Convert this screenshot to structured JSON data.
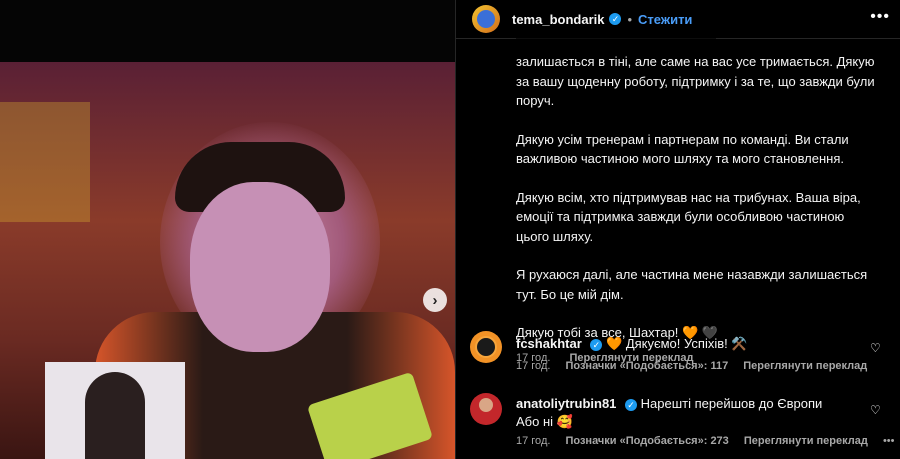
{
  "post": {
    "username": "tema_bondarik",
    "follow_label": "Стежити",
    "more_icon": "•••",
    "caption_paragraphs": [
      "залишається в тіні, але саме на вас усе тримається. Дякую за вашу щоденну роботу, підтримку і за те, що завжди були поруч.",
      "Дякую усім тренерам і партнерам по команді. Ви стали важливою частиною мого шляху та мого становлення.",
      "Дякую всім, хто підтримував нас на трибунах. Ваша віра, емоції та підтримка завжди були особливою частиною цього шляху.",
      "Я рухаюся далі, але частина мене назавжди залишається тут. Бо це мій дім."
    ],
    "caption_last": "Дякую тобі за все, Шахтар!",
    "caption_last_emojis": [
      "🧡",
      "🖤"
    ],
    "time": "17 год.",
    "translate_label": "Переглянути переклад"
  },
  "comments": [
    {
      "username": "fcshakhtar",
      "text": "Дякуємо! Успіхів!",
      "emoji_before": "🧡",
      "emoji_after": "⚒️",
      "time": "17 год.",
      "likes_label": "Позначки «Подобається»: 117",
      "translate_label": "Переглянути переклад"
    },
    {
      "username": "anatoliytrubin81",
      "text": "Нарешті перейшов до Європи",
      "text_line2": "Або ні",
      "emoji_after": "🥰",
      "time": "17 год.",
      "likes_label": "Позначки «Подобається»: 273",
      "translate_label": "Переглянути переклад",
      "more_icon": "•••"
    }
  ],
  "colors": {
    "accent": "#4a9df8",
    "verified": "#1d9bf0",
    "background": "#000000",
    "muted_text": "#a8a8a8"
  },
  "icons": {
    "next": "›",
    "heart": "♡",
    "verified": "✓"
  }
}
